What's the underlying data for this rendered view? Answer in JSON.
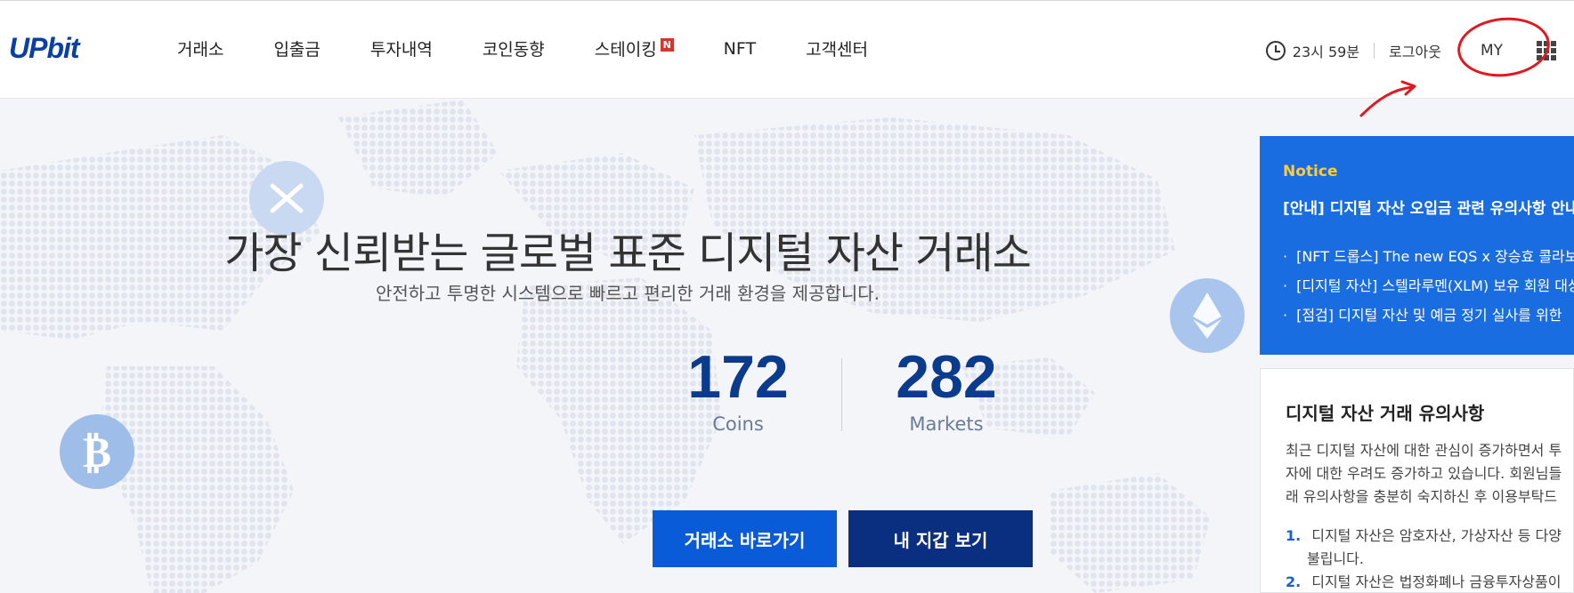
{
  "header": {
    "logo": "UPbit",
    "nav": [
      {
        "label": "거래소"
      },
      {
        "label": "입출금"
      },
      {
        "label": "투자내역"
      },
      {
        "label": "코인동향"
      },
      {
        "label": "스테이킹",
        "badge": "N"
      },
      {
        "label": "NFT"
      },
      {
        "label": "고객센터"
      }
    ],
    "timer": "23시 59분",
    "logout": "로그아웃",
    "my": "MY"
  },
  "hero": {
    "title": "가장 신뢰받는 글로벌 표준 디지털 자산 거래소",
    "subtitle": "안전하고 투명한 시스템으로 빠르고 편리한 거래 환경을 제공합니다.",
    "stats": [
      {
        "value": "172",
        "label": "Coins"
      },
      {
        "value": "282",
        "label": "Markets"
      }
    ],
    "buttons": {
      "exchange": "거래소 바로가기",
      "wallet": "내 지갑 보기"
    }
  },
  "notice": {
    "title": "Notice",
    "headline": "[안내] 디지털 자산 오입금 관련 유의사항 안내",
    "items": [
      "[NFT 드롭스] The new EQS x 장승효 콜라보",
      "[디지털 자산] 스텔라루멘(XLM) 보유 회원 대상",
      "[점검] 디지털 자산 및 예금 정기 실사를 위한"
    ]
  },
  "warning": {
    "title": "디지털 자산 거래 유의사항",
    "body": [
      "최근 디지털 자산에 대한 관심이 증가하면서 투",
      "자에 대한 우려도 증가하고 있습니다. 회원님들",
      "래 유의사항을 충분히 숙지하신 후 이용부탁드"
    ],
    "list": [
      {
        "num": "1.",
        "text": "디지털 자산은 암호자산, 가상자산 등 다양",
        "cont": "불립니다."
      },
      {
        "num": "2.",
        "text": "디지털 자산은 법정화폐나 금융투자상품이"
      }
    ]
  },
  "colors": {
    "primary_blue": "#0a5bd8",
    "dark_blue": "#0a2f80",
    "notice_blue": "#1a6de0",
    "notice_yellow": "#ffcc33",
    "annotation_red": "#e01820"
  }
}
